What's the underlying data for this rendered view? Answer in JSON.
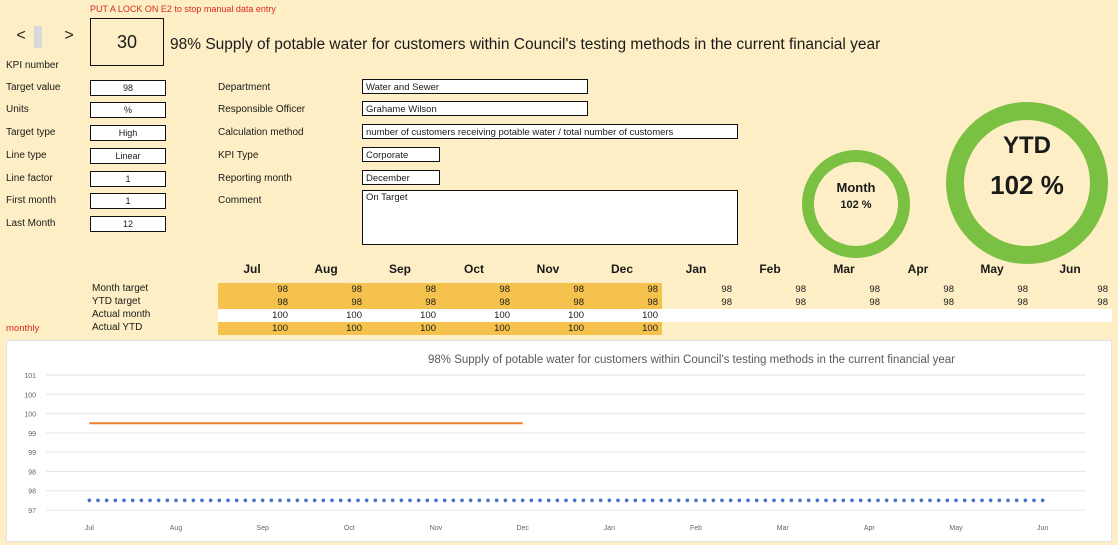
{
  "header": {
    "lock_note": "PUT A LOCK ON E2 to stop manual data entry",
    "nav_prev": "<",
    "nav_next": ">",
    "kpi_number": "30",
    "kpi_number_label": "KPI number",
    "kpi_title": "98% Supply of potable water for customers within Council's testing methods in the current financial year"
  },
  "left_fields": [
    {
      "label": "Target value",
      "value": "98"
    },
    {
      "label": "Units",
      "value": "%"
    },
    {
      "label": "Target type",
      "value": "High"
    },
    {
      "label": "Line type",
      "value": "Linear"
    },
    {
      "label": "Line factor",
      "value": "1"
    },
    {
      "label": "First month",
      "value": "1"
    },
    {
      "label": "Last Month",
      "value": "12"
    }
  ],
  "info_fields": [
    {
      "label": "Department",
      "value": "Water and Sewer"
    },
    {
      "label": "Responsible Officer",
      "value": "Grahame Wilson"
    },
    {
      "label": "Calculation method",
      "value": "number of customers receiving potable water / total number of customers"
    },
    {
      "label": "KPI Type",
      "value": "Corporate"
    },
    {
      "label": "Reporting month",
      "value": "December"
    },
    {
      "label": "Comment",
      "value": "On Target"
    }
  ],
  "gauges": {
    "month": {
      "label": "Month",
      "value": "102 %"
    },
    "ytd": {
      "label": "YTD",
      "value": "102 %"
    },
    "ring_color": "#7ac143"
  },
  "table": {
    "months": [
      "Jul",
      "Aug",
      "Sep",
      "Oct",
      "Nov",
      "Dec",
      "Jan",
      "Feb",
      "Mar",
      "Apr",
      "May",
      "Jun"
    ],
    "rows": [
      {
        "label": "Month target",
        "values": [
          "98",
          "98",
          "98",
          "98",
          "98",
          "98",
          "98",
          "98",
          "98",
          "98",
          "98",
          "98"
        ]
      },
      {
        "label": "YTD target",
        "values": [
          "98",
          "98",
          "98",
          "98",
          "98",
          "98",
          "98",
          "98",
          "98",
          "98",
          "98",
          "98"
        ]
      },
      {
        "label": "Actual month",
        "values": [
          "100",
          "100",
          "100",
          "100",
          "100",
          "100",
          "",
          "",
          "",
          "",
          "",
          ""
        ]
      },
      {
        "label": "Actual YTD",
        "values": [
          "100",
          "100",
          "100",
          "100",
          "100",
          "100",
          "",
          "",
          "",
          "",
          "",
          ""
        ]
      }
    ],
    "monthly_label": "monthly"
  },
  "chart_data": {
    "type": "line",
    "title": "98% Supply of potable water for customers within Council's testing methods in the current financial year",
    "categories": [
      "Jul",
      "Aug",
      "Sep",
      "Oct",
      "Nov",
      "Dec",
      "Jan",
      "Feb",
      "Mar",
      "Apr",
      "May",
      "Jun"
    ],
    "y_ticks": [
      "97",
      "98",
      "98",
      "99",
      "99",
      "100",
      "100",
      "101"
    ],
    "ylim": [
      97.75,
      101.25
    ],
    "series": [
      {
        "values": [
          100,
          100,
          100,
          100,
          100,
          100
        ],
        "color": "#ed7d31",
        "style": "solid"
      },
      {
        "values": [
          98,
          98,
          98,
          98,
          98,
          98,
          98,
          98,
          98,
          98,
          98,
          98
        ],
        "color": "#4472c4",
        "style": "dotted"
      }
    ],
    "grid": true
  }
}
